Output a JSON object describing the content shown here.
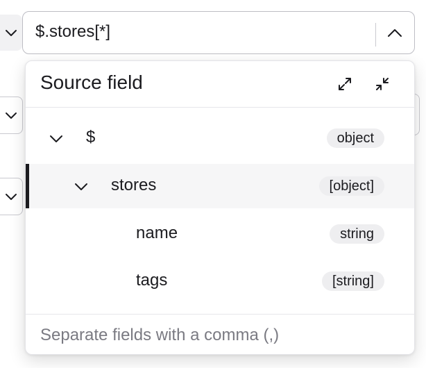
{
  "selector": {
    "value": "$.stores[*]",
    "toggle_icon": "chevron-up-icon"
  },
  "popover": {
    "title": "Source field",
    "expand_icon": "expand-icon",
    "collapse_icon": "collapse-icon",
    "tree": [
      {
        "label": "$",
        "type": "object",
        "depth": 0,
        "expanded": true,
        "selected": false
      },
      {
        "label": "stores",
        "type": "[object]",
        "depth": 1,
        "expanded": true,
        "selected": true
      },
      {
        "label": "name",
        "type": "string",
        "depth": 2,
        "expanded": false,
        "selected": false
      },
      {
        "label": "tags",
        "type": "[string]",
        "depth": 2,
        "expanded": false,
        "selected": false
      }
    ],
    "footer_placeholder": "Separate fields with a comma (,)"
  },
  "colors": {
    "text": "#1b1b1f",
    "badge_bg": "#eeeef0",
    "selected_row_bg": "#f6f6f7",
    "selected_marker": "#1b1b1f",
    "border": "#bdbdc4",
    "placeholder": "#7a7a82"
  }
}
